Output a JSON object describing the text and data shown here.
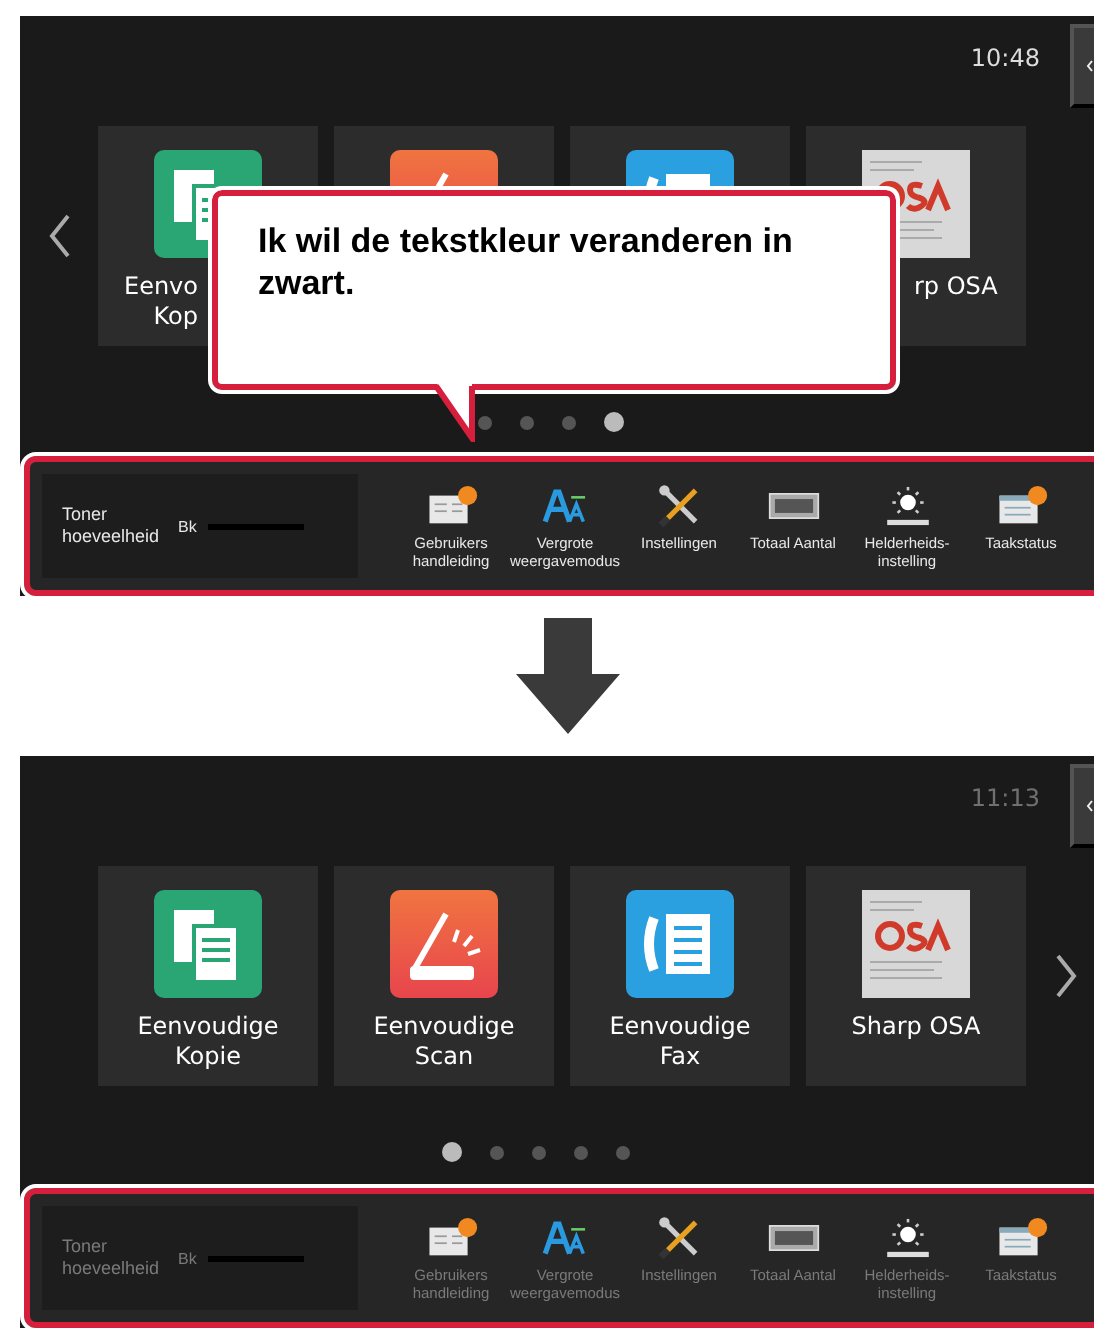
{
  "screens": [
    {
      "time": "10:48",
      "dark_text": false,
      "prev_arrow": true,
      "next_arrow": false,
      "tiles": [
        {
          "kind": "copy",
          "label_lines": [
            "Eenvo",
            "Kop"
          ],
          "cut_on_right": true,
          "cut_on_left": false
        },
        {
          "kind": "scan"
        },
        {
          "kind": "fax"
        },
        {
          "kind": "osa",
          "label_lines": [
            "rp OSA"
          ],
          "cut_on_right": false,
          "cut_on_left": true
        }
      ],
      "dots": [
        {
          "selected": false
        },
        {
          "selected": false
        },
        {
          "selected": false
        },
        {
          "selected": true
        }
      ],
      "callout": {
        "text": "Ik wil de tekstkleur veranderen in zwart."
      },
      "toolbar": {
        "toner_label": "Toner hoeveelheid",
        "toner_color": "Bk",
        "items": [
          {
            "kind": "manual",
            "label": "Gebruikers handleiding"
          },
          {
            "kind": "zoom",
            "label": "Vergrote weergavemodus"
          },
          {
            "kind": "settings",
            "label": "Instellingen"
          },
          {
            "kind": "counter",
            "label": "Totaal Aantal"
          },
          {
            "kind": "brightness",
            "label": "Helderheids-instelling"
          },
          {
            "kind": "jobs",
            "label": "Taakstatus"
          }
        ]
      }
    },
    {
      "time": "11:13",
      "dark_text": true,
      "prev_arrow": false,
      "next_arrow": true,
      "tiles": [
        {
          "kind": "copy",
          "label_lines": [
            "Eenvoudige",
            "Kopie"
          ],
          "cut_on_right": false,
          "cut_on_left": false
        },
        {
          "kind": "scan",
          "label_lines": [
            "Eenvoudige",
            "Scan"
          ],
          "cut_on_right": false,
          "cut_on_left": false
        },
        {
          "kind": "fax",
          "label_lines": [
            "Eenvoudige",
            "Fax"
          ],
          "cut_on_right": false,
          "cut_on_left": false
        },
        {
          "kind": "osa",
          "label_lines": [
            "Sharp OSA"
          ],
          "cut_on_right": false,
          "cut_on_left": false
        }
      ],
      "dots": [
        {
          "selected": true
        },
        {
          "selected": false
        },
        {
          "selected": false
        },
        {
          "selected": false
        },
        {
          "selected": false
        }
      ],
      "toolbar": {
        "toner_label": "Toner hoeveelheid",
        "toner_color": "Bk",
        "items": [
          {
            "kind": "manual",
            "label": "Gebruikers handleiding"
          },
          {
            "kind": "zoom",
            "label": "Vergrote weergavemodus"
          },
          {
            "kind": "settings",
            "label": "Instellingen"
          },
          {
            "kind": "counter",
            "label": "Totaal Aantal"
          },
          {
            "kind": "brightness",
            "label": "Helderheids-instelling"
          },
          {
            "kind": "jobs",
            "label": "Taakstatus"
          }
        ]
      }
    }
  ]
}
